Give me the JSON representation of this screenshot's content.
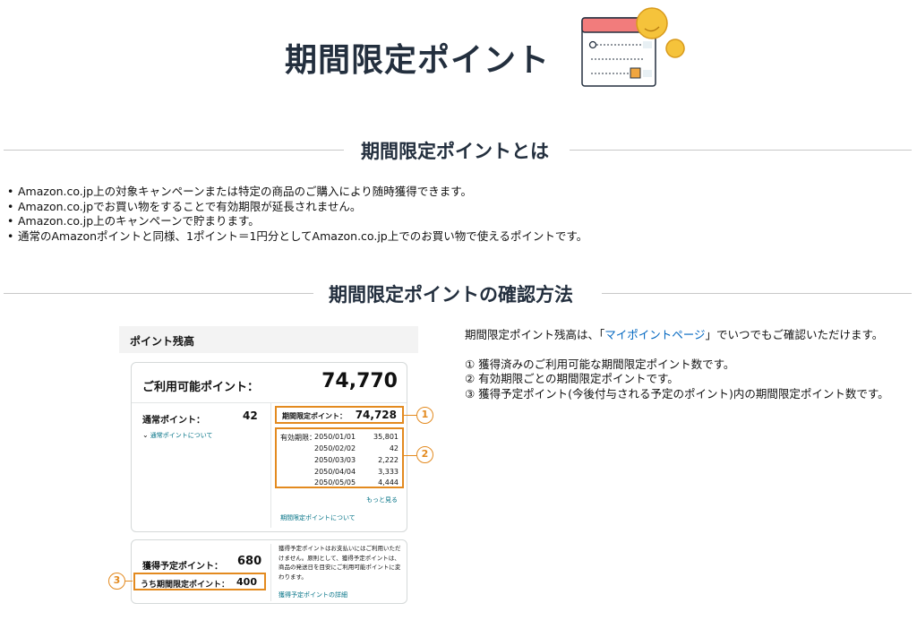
{
  "page": {
    "title": "期間限定ポイント"
  },
  "sections": {
    "about_title": "期間限定ポイントとは",
    "check_title": "期間限定ポイントの確認方法"
  },
  "bullets": [
    "Amazon.co.jp上の対象キャンペーンまたは特定の商品のご購入により随時獲得できます。",
    "Amazon.co.jpでお買い物をすることで有効期限が延長されません。",
    "Amazon.co.jp上のキャンペーンで貯まります。",
    "通常のAmazonポイントと同様、1ポイント＝1円分としてAmazon.co.jp上でのお買い物で使えるポイントです。"
  ],
  "explain": {
    "lead_before": "期間限定ポイント残高は、「",
    "lead_link": "マイポイントページ",
    "lead_after": "」でいつでもご確認いただけます。",
    "items": [
      "① 獲得済みのご利用可能な期間限定ポイント数です。",
      "② 有効期限ごとの期間限定ポイントです。",
      "③ 獲得予定ポイント(今後付与される予定のポイント)内の期間限定ポイント数です。"
    ]
  },
  "mock": {
    "header": "ポイント残高",
    "available_label": "ご利用可能ポイント：",
    "available_value": "74,770",
    "normal_label": "通常ポイント：",
    "normal_value": "42",
    "normal_link": "通常ポイントについて",
    "limited_label": "期間限定ポイント：",
    "limited_value": "74,728",
    "expiry_key": "有効期限：",
    "expiry_rows": [
      {
        "date": "2050/01/01",
        "value": "35,801"
      },
      {
        "date": "2050/02/02",
        "value": "42"
      },
      {
        "date": "2050/03/03",
        "value": "2,222"
      },
      {
        "date": "2050/04/04",
        "value": "3,333"
      },
      {
        "date": "2050/05/05",
        "value": "4,444"
      }
    ],
    "more_link": "もっと見る",
    "about_link": "期間限定ポイントについて",
    "planned_label": "獲得予定ポイント：",
    "planned_value": "680",
    "planned_limited_label": "うち期間限定ポイント：",
    "planned_limited_value": "400",
    "planned_note": "獲得予定ポイントはお支払いにはご利用いただけません。原則として、獲得予定ポイントは、商品の発送日を目安にご利用可能ポイントに変わります。",
    "planned_detail": "獲得予定ポイントの詳細"
  },
  "callouts": {
    "one": "1",
    "two": "2",
    "three": "3"
  },
  "colors": {
    "accent_orange": "#e38a1f",
    "link_blue": "#0066c0",
    "link_teal": "#007185",
    "heading_navy": "#232f3e"
  }
}
